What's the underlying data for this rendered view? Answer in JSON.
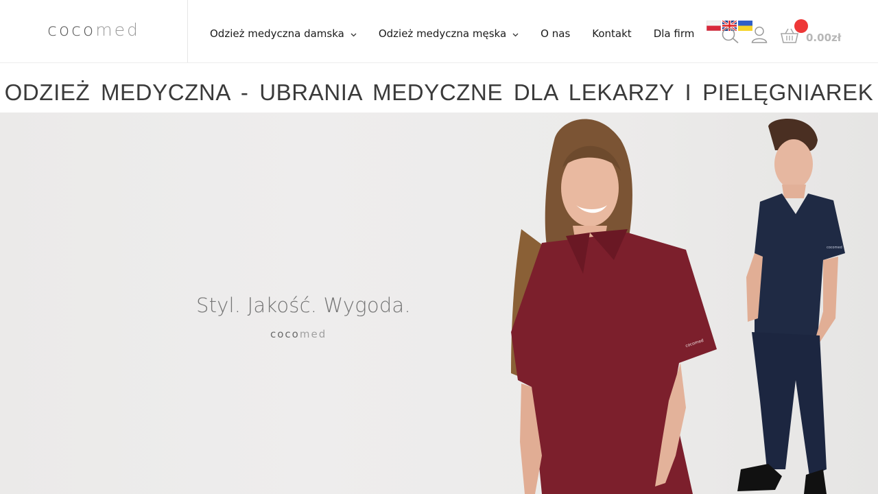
{
  "header": {
    "logo": {
      "part1": "coco",
      "part2": "med"
    },
    "nav": [
      {
        "label": "Odzież medyczna damska",
        "has_dropdown": true
      },
      {
        "label": "Odzież medyczna męska",
        "has_dropdown": true
      },
      {
        "label": "O nas",
        "has_dropdown": false
      },
      {
        "label": "Kontakt",
        "has_dropdown": false
      },
      {
        "label": "Dla firm",
        "has_dropdown": false
      }
    ],
    "languages": [
      "flag-poland",
      "flag-uk",
      "flag-ukraine"
    ],
    "icons": {
      "search": "search-icon",
      "account": "user-icon",
      "cart": "basket-icon"
    },
    "cart_total": "0.00zł",
    "accent_color": "#ee3737"
  },
  "page_title": "ODZIEŻ MEDYCZNA - UBRANIA MEDYCZNE DLA LEKARZY I PIELĘGNIAREK",
  "hero": {
    "tagline": "Styl. Jakość. Wygoda.",
    "brand": {
      "part1": "coco",
      "part2": "med"
    },
    "colors": {
      "burgundy": "#7c1f2c",
      "navy": "#1f2a44"
    }
  }
}
